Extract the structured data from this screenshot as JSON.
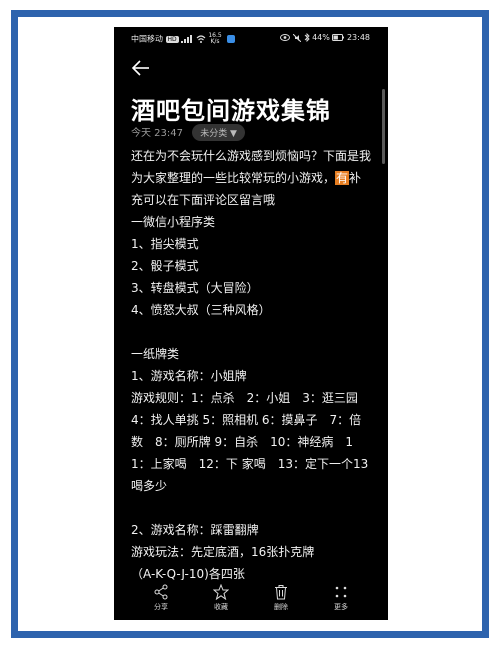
{
  "status_bar": {
    "carrier": "中国移动",
    "hd": "HD",
    "speed_value": "16.5",
    "speed_unit": "K/s",
    "battery": "44%",
    "time": "23:48"
  },
  "note": {
    "title": "酒吧包间游戏集锦",
    "time": "今天 23:47",
    "category": "未分类 ▼"
  },
  "content": {
    "intro_a": "还在为不会玩什么游戏感到烦恼吗？下面是我为大家整理的一些比较常玩的小游戏，",
    "intro_highlight": "有",
    "intro_b": "补充可以在下面评论区留言哦",
    "s1_title": "一微信小程序类",
    "s1_items": [
      "1、指尖模式",
      "2、骰子模式",
      "3、转盘模式（大冒险）",
      "4、愤怒大叔（三种风格）"
    ],
    "s2_title": "一纸牌类",
    "s2_game1_name": "1、游戏名称：小姐牌",
    "s2_game1_rules": "游戏规则：1：点杀　2：小姐　3：逛三园　4：找人单挑 5：照相机 6：摸鼻子　7：倍数　8：厕所牌 9：自杀　10：神经病　11：上家喝　12：下 家喝　13：定下一个13喝多少",
    "s2_game2_name": "2、游戏名称：踩雷翻牌",
    "s2_game2_rules": "游戏玩法：先定底酒，16张扑克牌",
    "s2_game2_more": "（A-K-Q-J-10)各四张"
  },
  "toolbar": {
    "share": "分享",
    "favorite": "收藏",
    "delete": "删除",
    "more": "更多"
  },
  "colors": {
    "frame": "#2d63ad",
    "highlight": "#e67e22"
  }
}
